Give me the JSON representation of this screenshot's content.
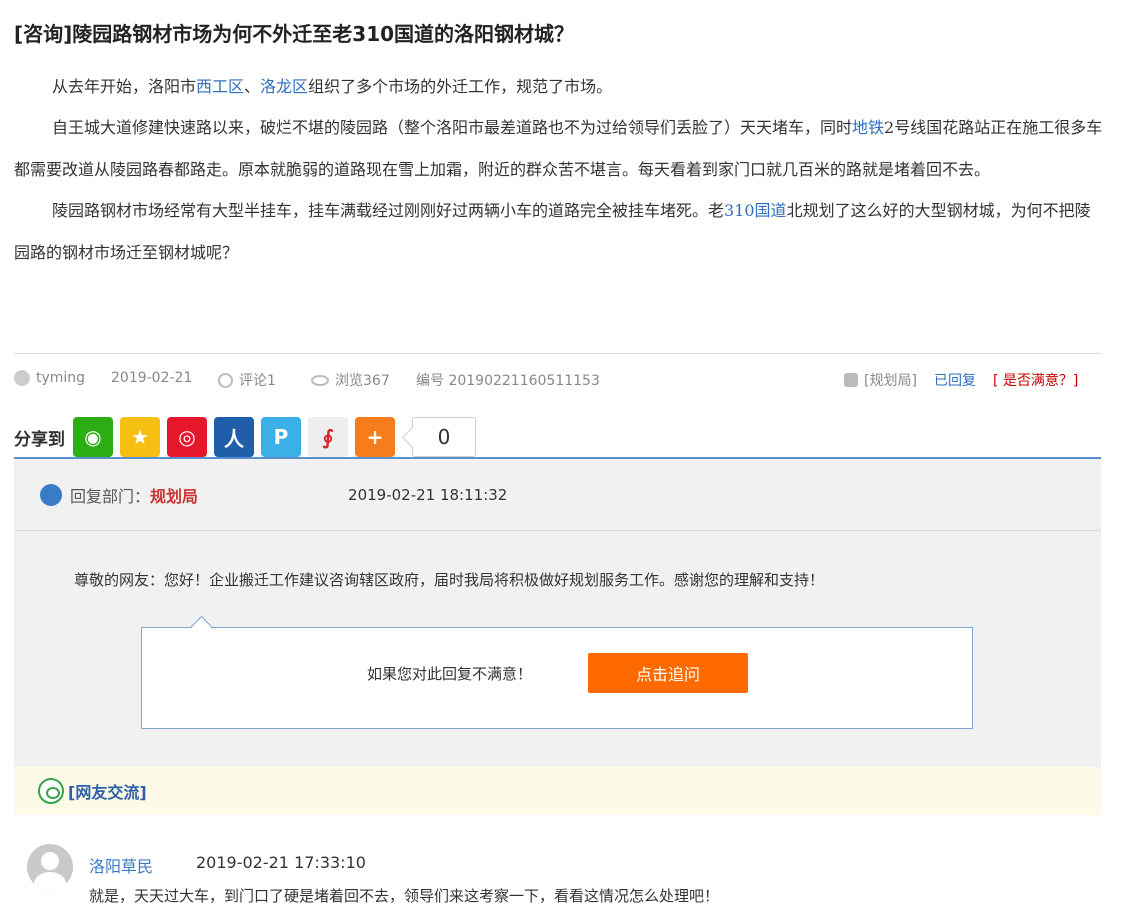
{
  "title": {
    "tag": "[咨询]",
    "text": "陵园路钢材市场为何不外迁至老310国道的洛阳钢材城？"
  },
  "article": {
    "p1": {
      "a": "从去年开始，洛阳市",
      "l1": "西工区",
      "b": "、",
      "l2": "洛龙区",
      "c": "组织了多个市场的外迁工作，规范了市场。"
    },
    "p2": {
      "a": "自王城大道修建快速路以来，破烂不堪的陵园路（整个洛阳市最差道路也不为过给领导们丢脸了）天天堵车，同时",
      "l1": "地铁",
      "b": "2号线国花路站正在施工很多车都需要改道从陵园路春都路走。原本就脆弱的道路现在雪上加霜，附近的群众苦不堪言。每天看着到家门口就几百米的路就是堵着回不去。"
    },
    "p3": {
      "a": "陵园路钢材市场经常有大型半挂车，挂车满载经过刚刚好过两辆小车的道路完全被挂车堵死。老",
      "l1": "310国道",
      "b": "北规划了这么好的大型钢材城，为何不把陵园路的钢材市场迁至钢材城呢？"
    }
  },
  "meta": {
    "user": "tyming",
    "date": "2019-02-21",
    "comments": "评论1",
    "views": "浏览367",
    "number": "编号 20190221160511153",
    "dept": "[规划局]",
    "status": "已回复",
    "satisfy": "[ 是否满意？]"
  },
  "share": {
    "label": "分享到",
    "count": "0",
    "buttons": [
      {
        "name": "wechat-icon",
        "color": "#2bad13",
        "glyph": "◉"
      },
      {
        "name": "qzone-icon",
        "color": "#f6c012",
        "glyph": "★"
      },
      {
        "name": "weibo-icon",
        "color": "#e6162d",
        "glyph": "◎"
      },
      {
        "name": "renren-icon",
        "color": "#1f5ea8",
        "glyph": "人"
      },
      {
        "name": "tencent-weibo-icon",
        "color": "#3bb0e6",
        "glyph": "P"
      },
      {
        "name": "red-icon",
        "color": "#d8262a",
        "glyph": "∮"
      },
      {
        "name": "more-icon",
        "color": "#f67c1c",
        "glyph": "+"
      }
    ]
  },
  "reply": {
    "label": "回复部门：",
    "dept": "规划局",
    "time": "2019-02-21 18:11:32",
    "body": "尊敬的网友：您好！企业搬迁工作建议咨询辖区政府，届时我局将积极做好规划服务工作。感谢您的理解和支持！",
    "followup_text": "如果您对此回复不满意！",
    "followup_button": "点击追问"
  },
  "exchange": {
    "title": "[网友交流]"
  },
  "comment": {
    "user": "洛阳草民",
    "time": "2019-02-21 17:33:10",
    "text": "就是，天天过大车，到门口了硬是堵着回不去，领导们来这考察一下，看看这情况怎么处理吧！"
  }
}
